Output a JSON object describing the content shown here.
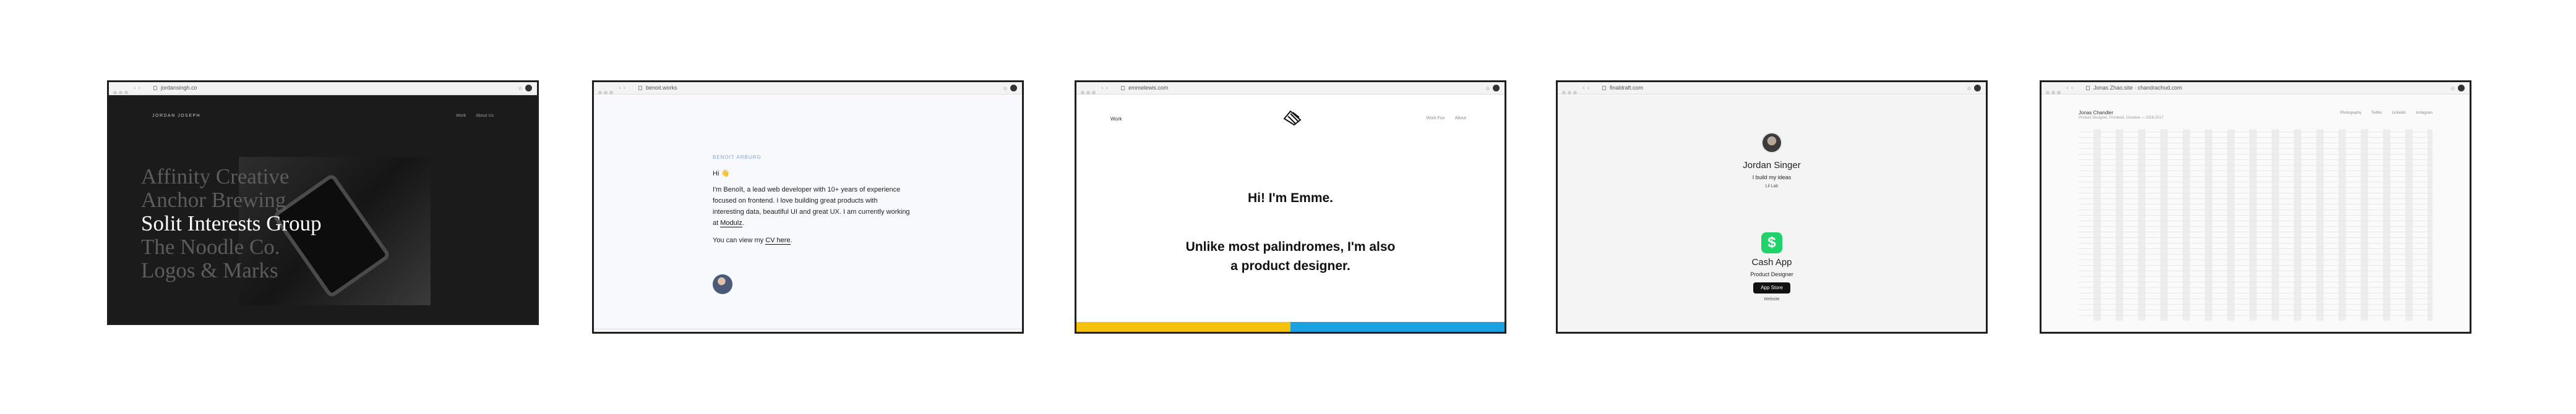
{
  "screenshots": [
    {
      "url": "jordansingh.co",
      "logo": "JORDAN JOSEPH",
      "nav": [
        "Work",
        "About Us"
      ],
      "lines": [
        "Affinity Creative",
        "Anchor Brewing",
        "Solit Interests Group",
        "The Noodle Co.",
        "Logos & Marks"
      ]
    },
    {
      "url": "benoit.works",
      "name": "BENOIT ARBURG",
      "greeting": "Hi 👋",
      "intro": "I'm Benoît, a lead web developer with 10+ years of experience focused on frontend. I love building great products with interesting data, beautiful UI and great UX. I am currently working at ",
      "company": "Modulz",
      "intro_end": ".",
      "cv_prefix": "You can view my ",
      "cv_link": "CV here",
      "cv_end": "."
    },
    {
      "url": "emmelewis.com",
      "left_nav": "Work",
      "right_nav": [
        "Work Fun",
        "About"
      ],
      "heading": "Hi! I'm Emme.",
      "subheading": "Unlike most palindromes, I'm also a product designer."
    },
    {
      "url": "finaldraft.com",
      "name": "Jordan Singer",
      "tagline": "I build my ideas",
      "small_link": "Lil Lab",
      "app_icon": "$",
      "app_name": "Cash App",
      "role": "Product Designer",
      "store_badge": "App Store",
      "footer_link": "Website"
    },
    {
      "url": "Jonas Zhao.site · chandrachud.com",
      "title": "Jonas Chandler",
      "subtitle": "Product Designer, Frontend, Creative — 2016-2017",
      "nav": [
        "Photography",
        "Twitter",
        "LinkedIn",
        "Instagram"
      ]
    }
  ]
}
